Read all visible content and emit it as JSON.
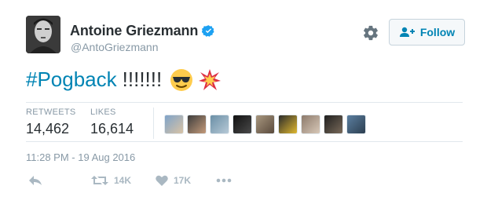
{
  "tweet": {
    "author": {
      "name": "Antoine Griezmann",
      "handle": "@AntoGriezmann"
    },
    "follow_label": "Follow",
    "text": {
      "hashtag": "#Pogback",
      "exclamations": "!!!!!!!",
      "emoji": [
        "sunglasses-face",
        "collision"
      ]
    },
    "stats": {
      "retweets_label": "RETWEETS",
      "retweets_value": "14,462",
      "likes_label": "LIKES",
      "likes_value": "16,614"
    },
    "liked_by_avatars": 9,
    "timestamp": "11:28 PM - 19 Aug 2016",
    "actions": {
      "retweet_count": "14K",
      "like_count": "17K"
    }
  },
  "colors": {
    "link_blue": "#0084b4",
    "verified_blue": "#1da1f2",
    "muted_text": "#8899a6",
    "action_grey": "#aab8c2",
    "divider": "#e1e8ed"
  }
}
